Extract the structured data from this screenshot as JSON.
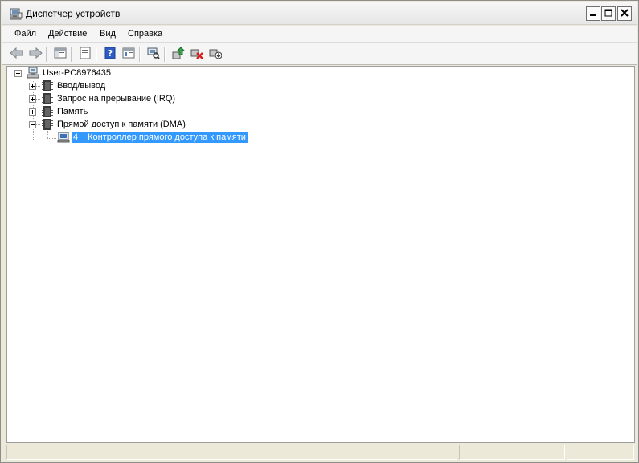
{
  "window": {
    "title": "Диспетчер устройств"
  },
  "menu": {
    "items": [
      "Файл",
      "Действие",
      "Вид",
      "Справка"
    ]
  },
  "toolbar": {
    "buttons": [
      "back-icon",
      "forward-icon",
      "console-tree-icon",
      "properties-icon",
      "help-icon",
      "view-icon",
      "scan-hardware-icon",
      "update-driver-icon",
      "uninstall-icon",
      "disable-icon"
    ]
  },
  "tree": {
    "root": "User-PC8976435",
    "categories": [
      {
        "label": "Ввод/вывод",
        "expanded": false
      },
      {
        "label": "Запрос на прерывание (IRQ)",
        "expanded": false
      },
      {
        "label": "Память",
        "expanded": false
      },
      {
        "label": "Прямой доступ к памяти (DMA)",
        "expanded": true
      }
    ],
    "child": {
      "number": "4",
      "label": "Контроллер прямого доступа к памяти"
    }
  },
  "colors": {
    "selection": "#3399ff",
    "frame": "#ece9d8"
  }
}
